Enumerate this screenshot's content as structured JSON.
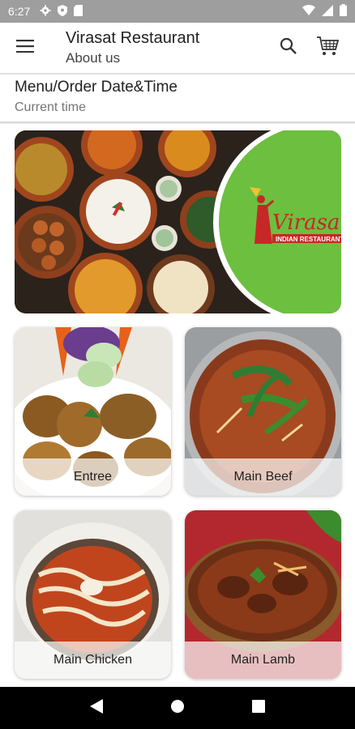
{
  "status_bar": {
    "time": "6:27",
    "left_icons": [
      "gear-icon",
      "shield-icon",
      "sd-card-icon"
    ],
    "right_icons": [
      "wifi-icon",
      "signal-icon",
      "battery-icon"
    ]
  },
  "app_bar": {
    "title": "Virasat Restaurant",
    "subtitle": "About us",
    "icons": [
      "menu-icon",
      "search-icon",
      "cart-icon"
    ]
  },
  "order_time": {
    "title": "Menu/Order Date&Time",
    "value": "Current time"
  },
  "banner": {
    "logo_text": "Virasat",
    "logo_subtext": "INDIAN RESTAURANT",
    "colors": {
      "green": "#6cbf3f",
      "logo_red": "#c62828"
    }
  },
  "categories": [
    {
      "label": "Entree"
    },
    {
      "label": "Main Beef"
    },
    {
      "label": "Main Chicken"
    },
    {
      "label": "Main Lamb"
    }
  ],
  "nav_bar": {
    "icons": [
      "back-icon",
      "home-icon",
      "recents-icon"
    ]
  }
}
